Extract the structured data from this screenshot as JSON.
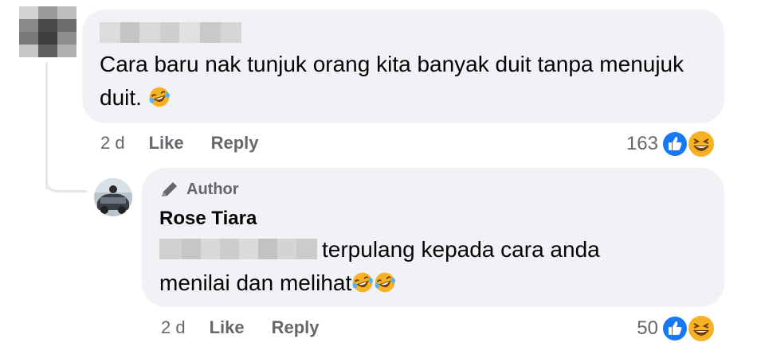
{
  "comment": {
    "text": "Cara baru nak tunjuk orang kita banyak duit tanpa menujuk duit.",
    "time": "2 d",
    "like_label": "Like",
    "reply_label": "Reply",
    "reaction_count": "163"
  },
  "reply": {
    "author_badge": "Author",
    "name": "Rose Tiara",
    "text_line1": "terpulang kepada cara anda",
    "text_line2": "menilai dan melihat",
    "time": "2 d",
    "like_label": "Like",
    "reply_label": "Reply",
    "reaction_count": "50"
  },
  "icons": [
    "laughing-emoji-icon",
    "like-reaction-icon",
    "haha-reaction-icon",
    "pencil-icon"
  ],
  "colors": {
    "bubble": "#f0f2f5",
    "meta_text": "#65676b",
    "like_blue": "#1877f2",
    "haha_yellow": "#f7b125"
  }
}
